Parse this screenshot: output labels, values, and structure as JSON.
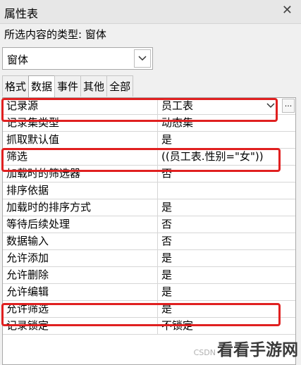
{
  "window": {
    "title": "属性表",
    "close_icon": "close-icon"
  },
  "selection_type": {
    "label": "所选内容的类型: 窗体"
  },
  "object_selector": {
    "value": "窗体"
  },
  "tabs": [
    {
      "label": "格式"
    },
    {
      "label": "数据",
      "active": true
    },
    {
      "label": "事件"
    },
    {
      "label": "其他"
    },
    {
      "label": "全部"
    }
  ],
  "properties": [
    {
      "name": "记录源",
      "value": "员工表"
    },
    {
      "name": "记录集类型",
      "value": "动态集"
    },
    {
      "name": "抓取默认值",
      "value": "是"
    },
    {
      "name": "筛选",
      "value": "((员工表.性别=\"女\"))"
    },
    {
      "name": "加载时的筛选器",
      "value": "否"
    },
    {
      "name": "排序依据",
      "value": ""
    },
    {
      "name": "加载时的排序方式",
      "value": "是"
    },
    {
      "name": "等待后续处理",
      "value": "否"
    },
    {
      "name": "数据输入",
      "value": "否"
    },
    {
      "name": "允许添加",
      "value": "是"
    },
    {
      "name": "允许删除",
      "value": "是"
    },
    {
      "name": "允许编辑",
      "value": "是"
    },
    {
      "name": "允许筛选",
      "value": "是"
    },
    {
      "name": "记录锁定",
      "value": "不锁定"
    }
  ],
  "record_source_builder": "...",
  "highlight_color": "#e02020",
  "watermark": {
    "csdn": "CSDN",
    "brand": "看看手游网"
  }
}
